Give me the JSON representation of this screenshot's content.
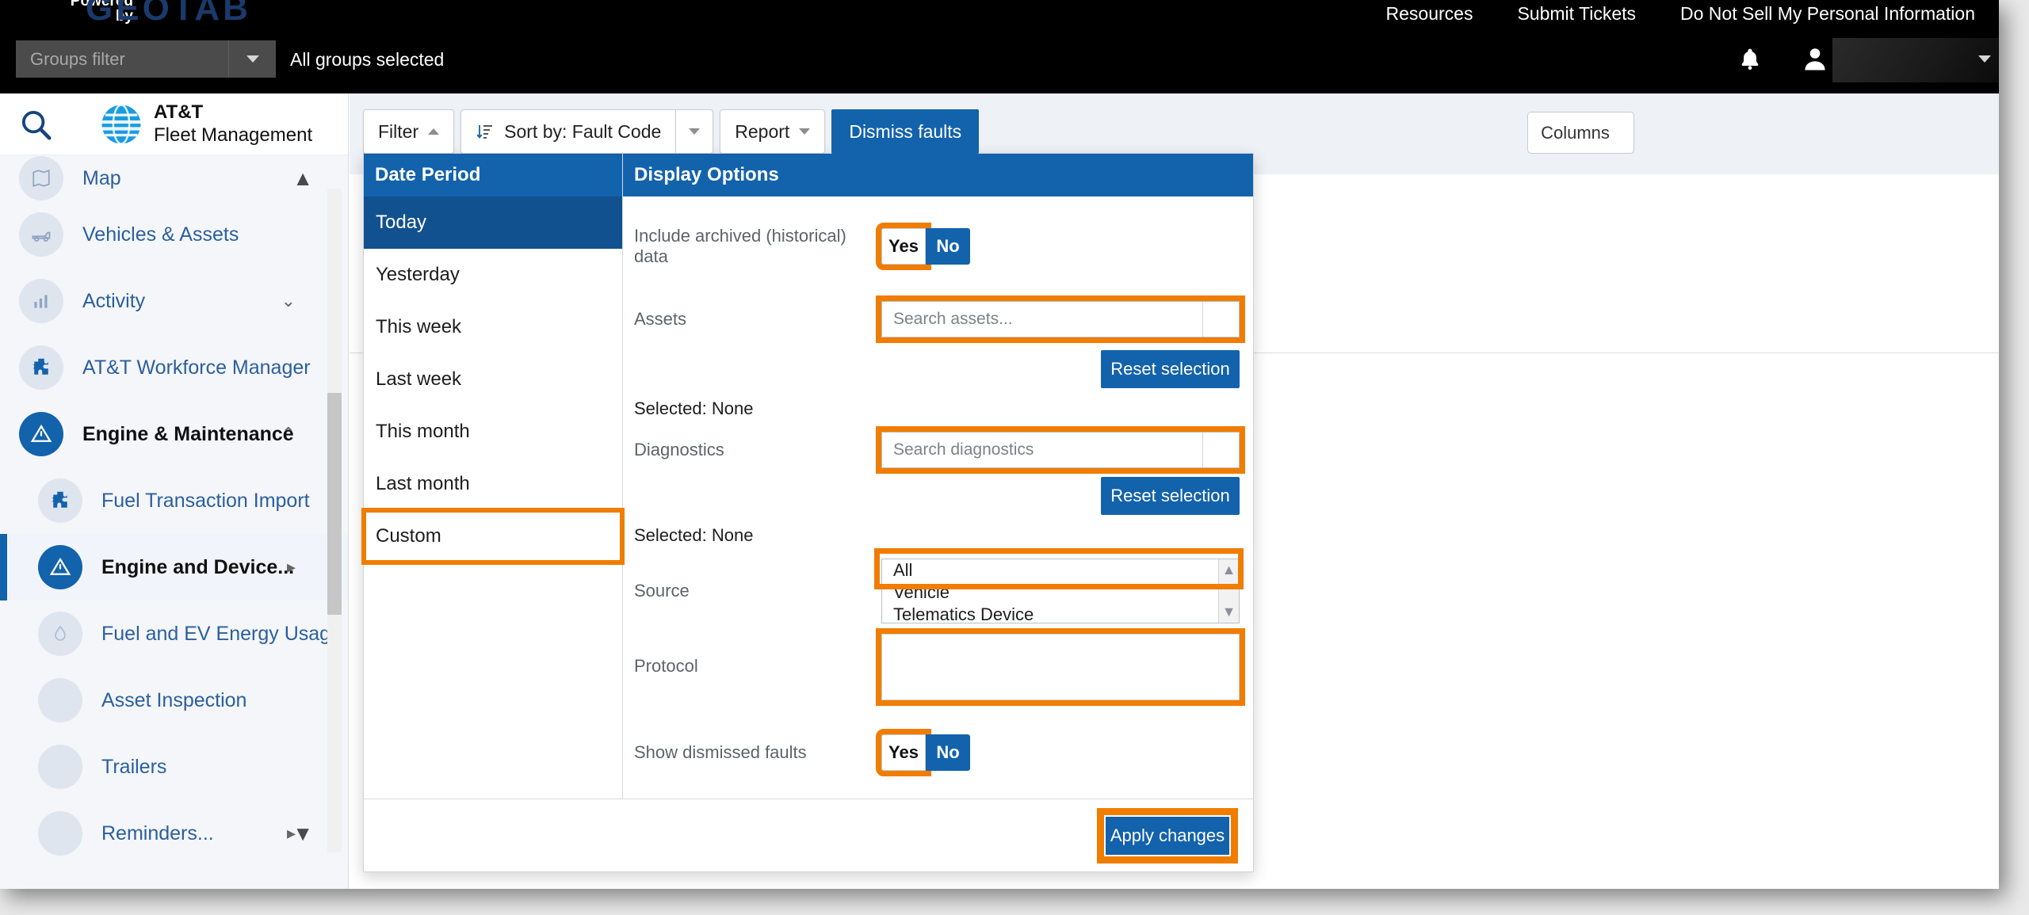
{
  "topbar": {
    "powered_line1": "Powered",
    "powered_line2": "by",
    "brand": "GEOTAB",
    "links": [
      "Resources",
      "Submit Tickets",
      "Do Not Sell My Personal Information"
    ],
    "groups_filter_placeholder": "Groups filter",
    "groups_selected_text": "All groups selected",
    "bell_icon": "bell-icon",
    "avatar_icon": "user-avatar-icon"
  },
  "sidebar": {
    "search_icon": "search-icon",
    "app_title_line1": "AT&T",
    "app_title_line2": "Fleet Management",
    "items": [
      {
        "label": "Map",
        "icon": "map-icon",
        "chevron": "",
        "state": "normal"
      },
      {
        "label": "Vehicles & Assets",
        "icon": "vehicle-icon",
        "chevron": "",
        "state": "normal"
      },
      {
        "label": "Activity",
        "icon": "chart-icon",
        "chevron": "chevron-down",
        "state": "normal"
      },
      {
        "label": "AT&T Workforce Manager",
        "icon": "puzzle-icon",
        "chevron": "",
        "state": "normal"
      },
      {
        "label": "Engine & Maintenance",
        "icon": "engine-warning-icon",
        "chevron": "chevron-up",
        "state": "active"
      },
      {
        "label": "Fuel Transaction Import",
        "icon": "puzzle-icon",
        "chevron": "",
        "state": "sub"
      },
      {
        "label": "Engine and Device...",
        "icon": "engine-warning-icon",
        "chevron": "chevron-right",
        "state": "sub-selected"
      },
      {
        "label": "Fuel and EV Energy Usage",
        "icon": "fuel-drop-icon",
        "chevron": "",
        "state": "sub"
      },
      {
        "label": "Asset Inspection",
        "icon": "inspection-icon",
        "chevron": "",
        "state": "sub"
      },
      {
        "label": "Trailers",
        "icon": "trailer-icon",
        "chevron": "",
        "state": "sub"
      },
      {
        "label": "Reminders...",
        "icon": "reminder-icon",
        "chevron": "chevron-right",
        "state": "sub"
      }
    ]
  },
  "toolbar": {
    "filter_label": "Filter",
    "sort_label": "Sort by:  Fault Code",
    "sort_icon": "sort-ascending-icon",
    "report_label": "Report",
    "dismiss_label": "Dismiss faults",
    "columns_label": "Columns"
  },
  "filter_panel": {
    "date_period": {
      "header": "Date Period",
      "items": [
        "Today",
        "Yesterday",
        "This week",
        "Last week",
        "This month",
        "Last month",
        "Custom"
      ],
      "selected": "Today",
      "highlighted": "Custom"
    },
    "display_options": {
      "header": "Display Options",
      "include_archived": {
        "label": "Include archived (historical) data",
        "yes": "Yes",
        "no": "No",
        "value": "No"
      },
      "assets": {
        "label": "Assets",
        "placeholder": "Search assets...",
        "reset_label": "Reset selection",
        "selected_text": "Selected: None"
      },
      "diagnostics": {
        "label": "Diagnostics",
        "placeholder": "Search diagnostics",
        "reset_label": "Reset selection",
        "selected_text": "Selected: None"
      },
      "source": {
        "label": "Source",
        "options": [
          "All",
          "Vehicle",
          "Telematics Device"
        ],
        "selected": "All"
      },
      "protocol": {
        "label": "Protocol",
        "value": ""
      },
      "show_dismissed": {
        "label": "Show dismissed faults",
        "yes": "Yes",
        "no": "No",
        "value": "No"
      },
      "apply_label": "Apply changes"
    }
  },
  "colors": {
    "brand_blue": "#1362ac",
    "highlight_orange": "#f07d00",
    "header_black": "#000000",
    "geotab_blue": "#1b3a6b"
  }
}
